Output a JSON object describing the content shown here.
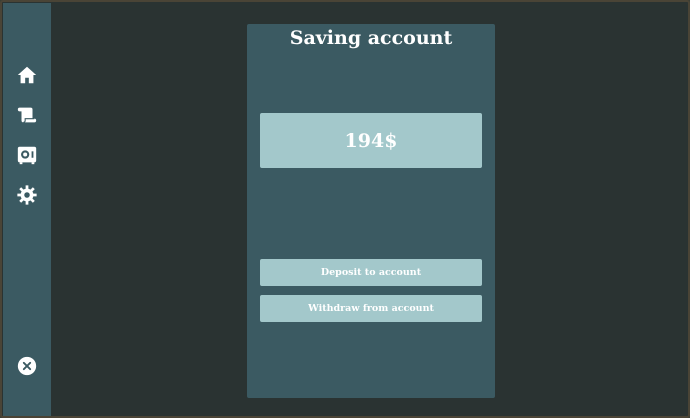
{
  "panel": {
    "title": "Saving account",
    "balance": "194$",
    "deposit_label": "Deposit to account",
    "withdraw_label": "Withdraw from account"
  },
  "sidebar": {
    "icons": [
      "home-icon",
      "scroll-icon",
      "safe-icon",
      "gear-icon"
    ],
    "close_icon": "close-icon"
  },
  "colors": {
    "background": "#2a3332",
    "panel": "#3b5a62",
    "button": "#a3c8cb",
    "text": "#ffffff"
  }
}
